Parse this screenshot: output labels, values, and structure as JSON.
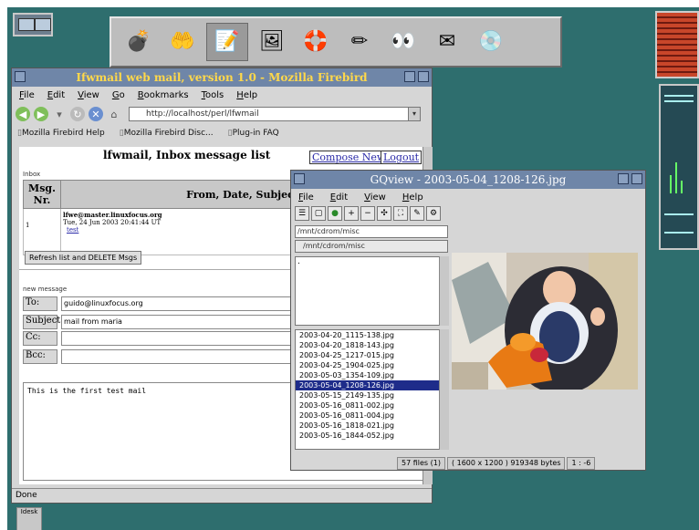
{
  "panel": {
    "launchers": [
      {
        "icon": "bomb-icon",
        "glyph": "💣"
      },
      {
        "icon": "hand-icon",
        "glyph": "🤲"
      },
      {
        "icon": "text-editor-icon",
        "glyph": "📝"
      },
      {
        "icon": "image-viewer-icon",
        "glyph": "🖼"
      },
      {
        "icon": "lifebuoy-icon",
        "glyph": "🛟"
      },
      {
        "icon": "pencil-icon",
        "glyph": "✏"
      },
      {
        "icon": "eyes-icon",
        "glyph": "👀"
      },
      {
        "icon": "mail-icon",
        "glyph": "✉"
      },
      {
        "icon": "cd-icon",
        "glyph": "💿"
      }
    ]
  },
  "firefox": {
    "title": "Ifwmail web mail, version 1.0 - Mozilla Firebird",
    "menu": [
      "File",
      "Edit",
      "View",
      "Go",
      "Bookmarks",
      "Tools",
      "Help"
    ],
    "url": "http://localhost/perl/lfwmail",
    "bookmarks": [
      "Mozilla Firebird Help",
      "Mozilla Firebird Disc...",
      "Plug-in FAQ"
    ],
    "page": {
      "heading": "lfwmail, Inbox message list",
      "compose_link": "Compose New",
      "logout_link": "Logout",
      "inbox_legend": "Inbox",
      "table_headers": {
        "num": "Msg. Nr.",
        "info": "From, Date, Subject"
      },
      "message": {
        "num": "1",
        "from": "lfwe@master.linuxfocus.org",
        "date": "Tue, 24 Jun 2003 20:41:44 UT",
        "subject": "test"
      },
      "refresh_button": "Refresh list and DELETE Msgs",
      "new_message_legend": "new message",
      "fields": {
        "to_label": "To:",
        "to_value": "guido@linuxfocus.org",
        "subject_label": "Subject:",
        "subject_value": "mail from maria",
        "cc_label": "Cc:",
        "cc_value": "",
        "bcc_label": "Bcc:",
        "bcc_value": ""
      },
      "body_text": "This is the first test mail"
    },
    "status": "Done"
  },
  "gqview": {
    "title": "GQview - 2003-05-04_1208-126.jpg",
    "menu": [
      "File",
      "Edit",
      "View",
      "Help"
    ],
    "path": "/mnt/cdrom/misc",
    "folder": "/mnt/cdrom/misc",
    "dirs": [
      "."
    ],
    "files": [
      "2003-04-20_1115-138.jpg",
      "2003-04-20_1818-143.jpg",
      "2003-04-25_1217-015.jpg",
      "2003-04-25_1904-025.jpg",
      "2003-05-03_1354-109.jpg",
      "2003-05-04_1208-126.jpg",
      "2003-05-15_2149-135.jpg",
      "2003-05-16_0811-002.jpg",
      "2003-05-16_0811-004.jpg",
      "2003-05-16_1818-021.jpg",
      "2003-05-16_1844-052.jpg"
    ],
    "selected_file": "2003-05-04_1208-126.jpg",
    "status": {
      "count": "57 files (1)",
      "info": "( 1600 x 1200 ) 919348 bytes",
      "zoom": "1 : -6"
    }
  },
  "taskbar": {
    "button": "Idesk"
  },
  "colors": {
    "desktop": "#2e6e6e",
    "titlebar": "#6f86a8",
    "title_text": "#ffd84a",
    "selection": "#1e2c8a"
  }
}
